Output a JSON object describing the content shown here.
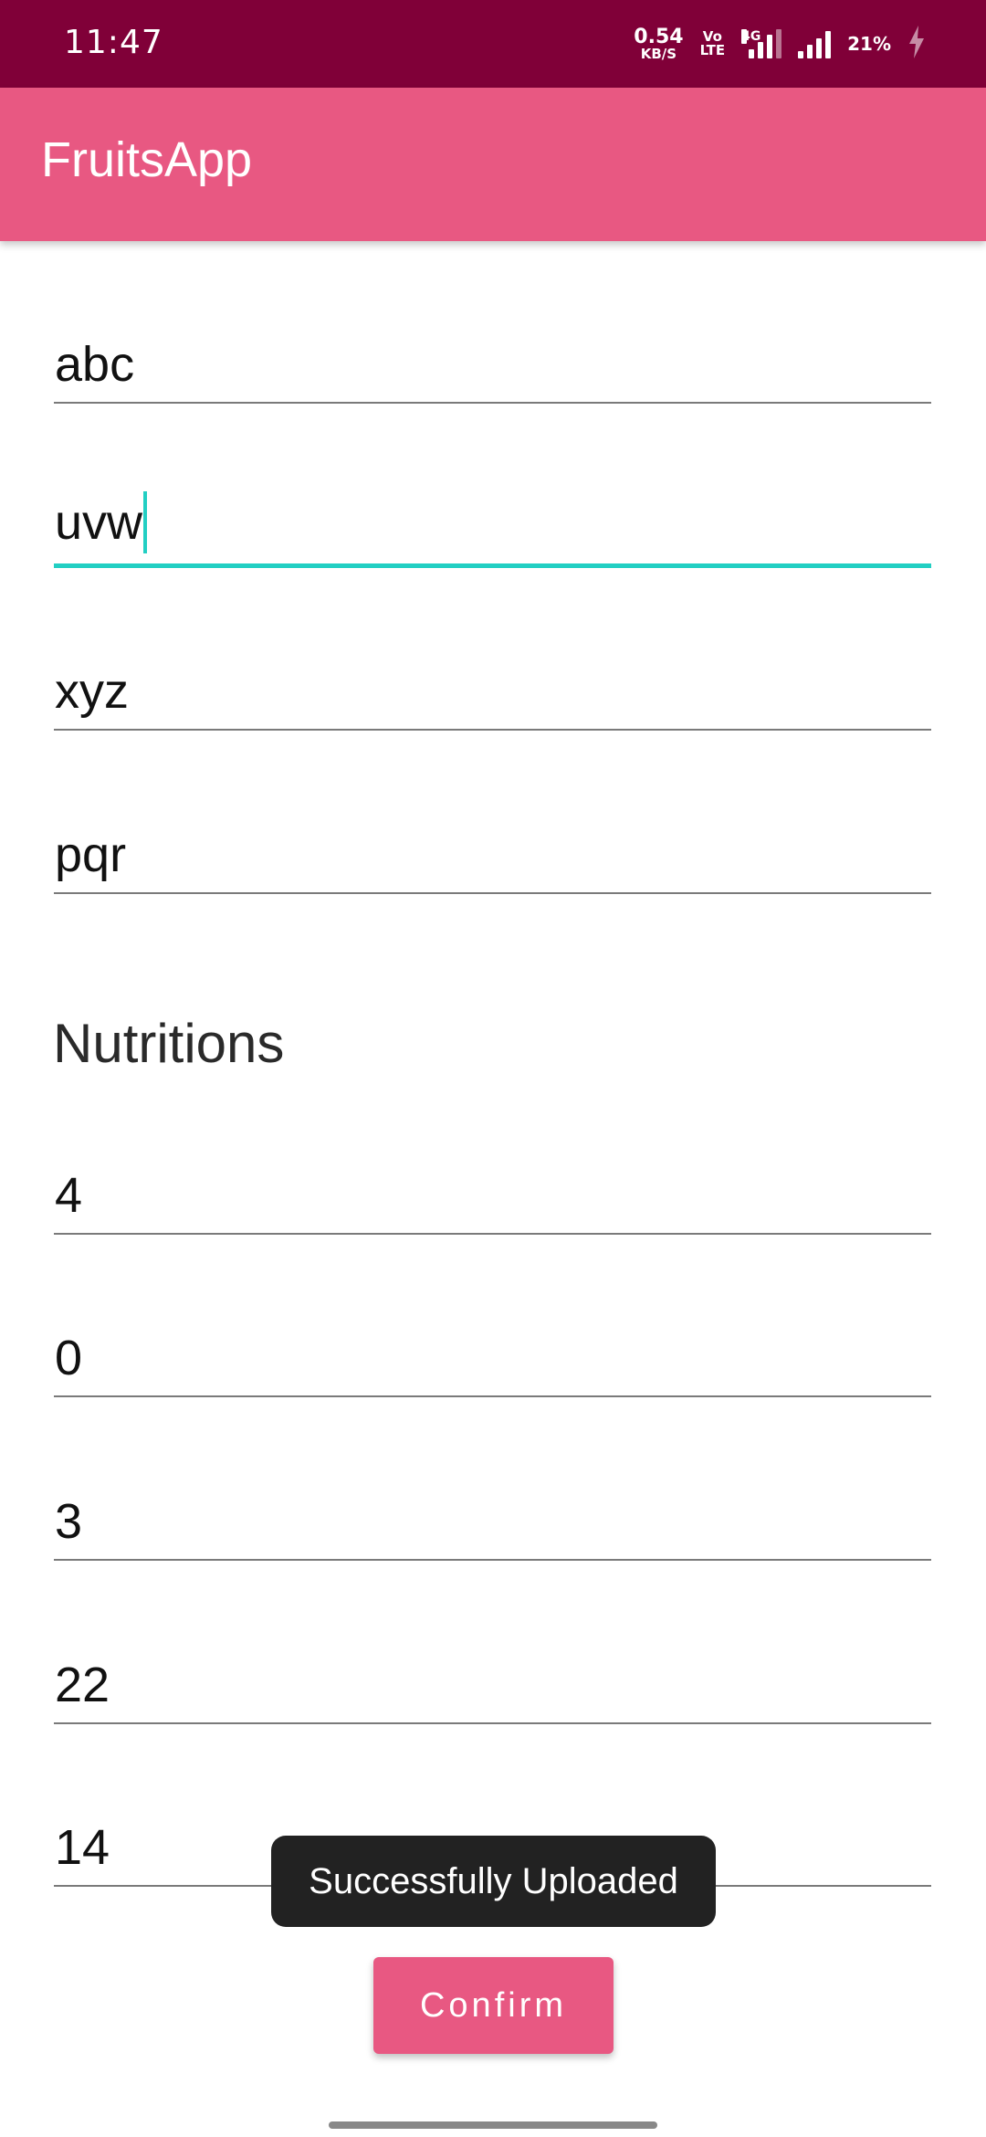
{
  "status_bar": {
    "time": "11:47",
    "net_speed_value": "0.54",
    "net_speed_unit": "KB/S",
    "volte_top": "Vo",
    "volte_bottom": "LTE",
    "network_type": "4G",
    "battery_percent": "21%",
    "icons": [
      "volte-icon",
      "signal-4g-icon",
      "signal-icon",
      "battery-charging-icon"
    ]
  },
  "app_bar": {
    "title": "FruitsApp"
  },
  "form": {
    "fields": [
      {
        "value": "abc",
        "focused": false
      },
      {
        "value": "uvw",
        "focused": true
      },
      {
        "value": "xyz",
        "focused": false
      },
      {
        "value": "pqr",
        "focused": false
      }
    ],
    "section_title": "Nutritions",
    "nutrition_fields": [
      {
        "value": "4"
      },
      {
        "value": "0"
      },
      {
        "value": "3"
      },
      {
        "value": "22"
      },
      {
        "value": "14"
      }
    ]
  },
  "toast": {
    "message": "Successfully Uploaded"
  },
  "confirm_button": {
    "label": "Confirm"
  },
  "colors": {
    "status_bar": "#800038",
    "primary": "#e85882",
    "accent": "#22cfc3",
    "toast_bg": "#222222"
  }
}
